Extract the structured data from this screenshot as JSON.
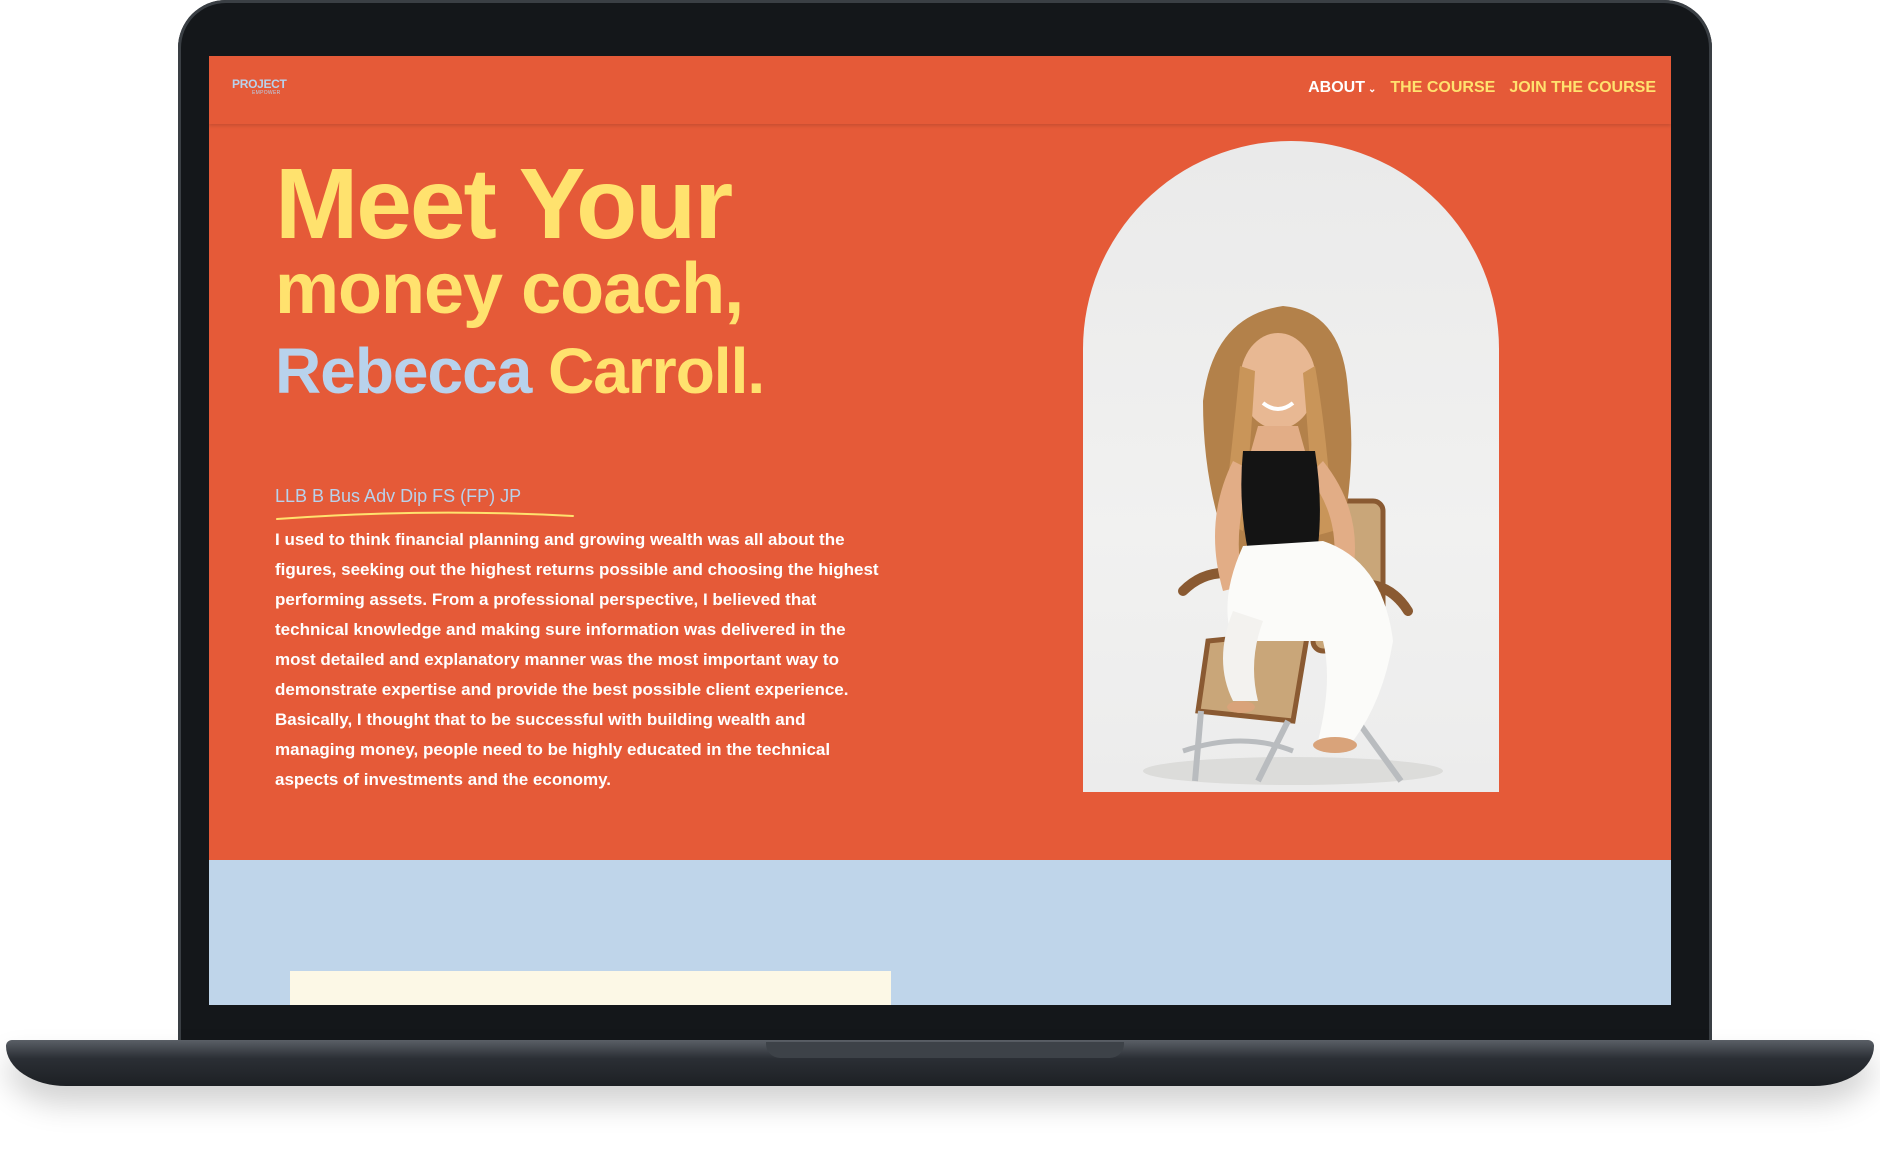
{
  "nav": {
    "logo_main": "PROJECT",
    "logo_sub": "EMPOWER",
    "about_label": "ABOUT",
    "course_label": "THE COURSE",
    "join_label": "JOIN THE COURSE"
  },
  "hero": {
    "line1": "Meet Your",
    "line2": "money coach,",
    "first_name": "Rebecca",
    "last_name": "Carroll."
  },
  "about": {
    "credentials": "LLB B Bus Adv Dip FS (FP) JP",
    "bio": "I used to think financial planning and growing wealth was all about the figures, seeking out the highest returns possible and choosing the highest performing assets. From a professional perspective, I believed that technical knowledge and making sure information was delivered in the most detailed and explanatory manner was the most important way to demonstrate expertise and provide the best possible client experience. Basically, I thought that to be successful with building wealth and managing money, people need to be highly educated in the technical aspects of investments and the economy."
  },
  "colors": {
    "primary": "#e55a38",
    "accent_yellow": "#ffe26e",
    "accent_blue": "#b8d2ec",
    "section_blue": "#bfd5ea",
    "cream": "#fcf8e6"
  }
}
